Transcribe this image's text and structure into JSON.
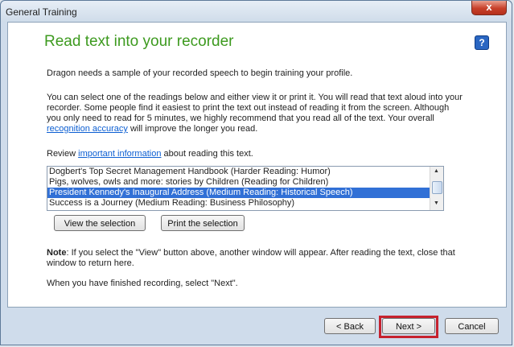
{
  "window": {
    "title": "General Training",
    "close_label": "x"
  },
  "header": {
    "title": "Read text into your recorder",
    "help_label": "?"
  },
  "intro": "Dragon needs a sample of your recorded speech to begin training your profile.",
  "instructions": {
    "text_before": "You can select one of the readings below and either view it or print it. You will read that text aloud into your recorder. Some people find it easiest to print the text out instead of reading it from the screen. Although you only need to read for 5 minutes, we highly recommend that you read all of the text. Your overall ",
    "link": "recognition accuracy",
    "text_after": " will improve the longer you read."
  },
  "review": {
    "before": "Review ",
    "link": "important information",
    "after": " about reading this text."
  },
  "readings": [
    {
      "label": "Dogbert's Top Secret Management Handbook (Harder Reading: Humor)",
      "selected": false
    },
    {
      "label": "Pigs, wolves, owls and more: stories by Children (Reading for Children)",
      "selected": false
    },
    {
      "label": "President Kennedy's Inaugural Address (Medium Reading: Historical Speech)",
      "selected": true
    },
    {
      "label": "Success is a Journey (Medium Reading: Business Philosophy)",
      "selected": false
    }
  ],
  "actions": {
    "view_label": "View the selection",
    "print_label": "Print the selection"
  },
  "note": {
    "bold": "Note",
    "text": ": If you select the \"View\" button above, another window will appear. After reading the text, close that window to return here."
  },
  "finish_text": "When you have finished recording, select \"Next\".",
  "footer": {
    "back_label": "< Back",
    "next_label": "Next >",
    "cancel_label": "Cancel"
  },
  "colors": {
    "heading": "#3d9a1f",
    "link": "#0b5ed2",
    "selection": "#3170d6",
    "highlight": "#c6222e"
  }
}
